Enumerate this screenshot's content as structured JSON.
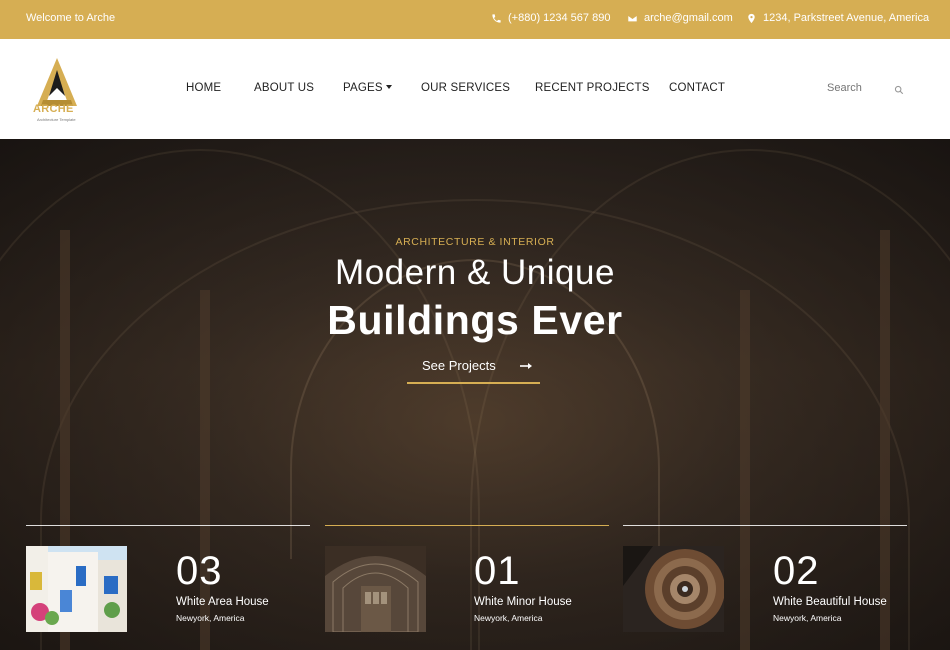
{
  "topbar": {
    "welcome": "Welcome to Arche",
    "phone": "(+880) 1234 567 890",
    "email": "arche@gmail.com",
    "address": "1234, Parkstreet Avenue, America"
  },
  "brand": {
    "name": "ARCHE",
    "tagline": "Architecture Template",
    "accent_color": "#d6ae53"
  },
  "nav": {
    "items": [
      "HOME",
      "ABOUT US",
      "PAGES",
      "OUR SERVICES",
      "RECENT PROJECTS",
      "CONTACT"
    ],
    "search_placeholder": "Search"
  },
  "hero": {
    "kicker": "ARCHITECTURE & INTERIOR",
    "line1": "Modern & Unique",
    "line2": "Buildings Ever",
    "cta": "See Projects"
  },
  "projects": [
    {
      "number": "03",
      "title": "White Area House",
      "location": "Newyork, America"
    },
    {
      "number": "01",
      "title": "White Minor House",
      "location": "Newyork, America"
    },
    {
      "number": "02",
      "title": "White Beautiful House",
      "location": "Newyork, America"
    }
  ],
  "icons": [
    "phone-icon",
    "mail-icon",
    "map-pin-icon",
    "search-icon",
    "arrow-right-icon",
    "chevron-down-icon"
  ]
}
